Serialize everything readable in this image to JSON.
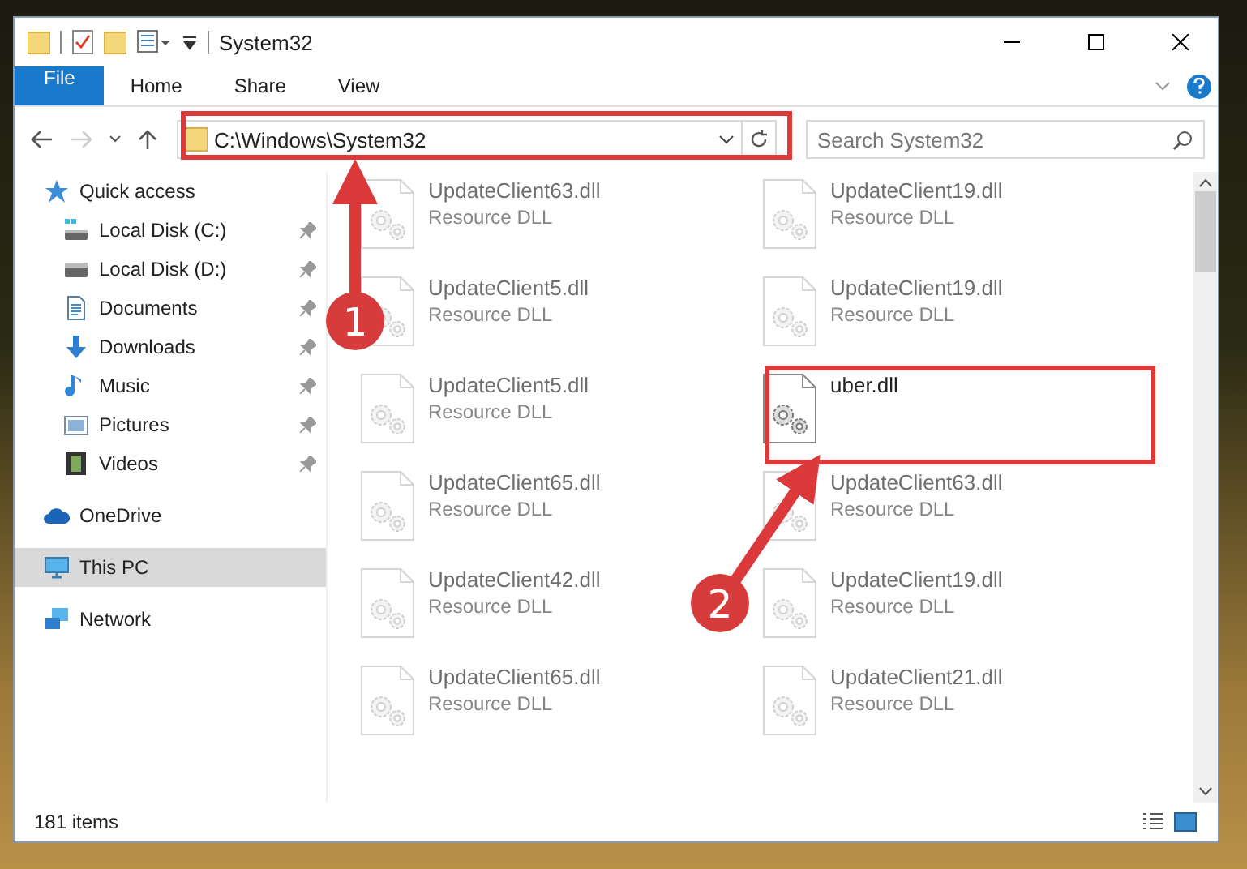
{
  "window": {
    "title": "System32"
  },
  "ribbon_tabs": [
    {
      "label": "File",
      "kind": "file",
      "selected": false
    },
    {
      "label": "Home",
      "kind": "tab",
      "selected": false
    },
    {
      "label": "Share",
      "kind": "tab",
      "selected": false
    },
    {
      "label": "View",
      "kind": "tab",
      "selected": false
    }
  ],
  "navigation": {
    "forward_disabled": true
  },
  "address_bar": {
    "path": "C:\\Windows\\System32"
  },
  "search": {
    "placeholder": "Search System32"
  },
  "sidebar": {
    "items": [
      {
        "label": "Quick access",
        "kind": "star",
        "selected": false,
        "children": [
          {
            "label": "Local Disk (C:)",
            "kind": "drive-c",
            "pinned": true,
            "selected": false
          },
          {
            "label": "Local Disk (D:)",
            "kind": "drive",
            "pinned": true,
            "selected": false
          },
          {
            "label": "Documents",
            "kind": "document",
            "pinned": true,
            "selected": false
          },
          {
            "label": "Downloads",
            "kind": "download",
            "pinned": true,
            "selected": false
          },
          {
            "label": "Music",
            "kind": "music",
            "pinned": true,
            "selected": false
          },
          {
            "label": "Pictures",
            "kind": "pictures",
            "pinned": true,
            "selected": false
          },
          {
            "label": "Videos",
            "kind": "videos",
            "pinned": true,
            "selected": false
          }
        ]
      },
      {
        "label": "OneDrive",
        "kind": "cloud",
        "selected": false
      },
      {
        "label": "This PC",
        "kind": "pc",
        "selected": true
      },
      {
        "label": "Network",
        "kind": "network",
        "selected": false
      }
    ]
  },
  "files": [
    {
      "name": "UpdateClient63.dll",
      "type": "Resource DLL",
      "dimmed": true
    },
    {
      "name": "UpdateClient19.dll",
      "type": "Resource DLL",
      "dimmed": true
    },
    {
      "name": "UpdateClient5.dll",
      "type": "Resource DLL",
      "dimmed": true
    },
    {
      "name": "UpdateClient19.dll",
      "type": "Resource DLL",
      "dimmed": true
    },
    {
      "name": "UpdateClient5.dll",
      "type": "Resource DLL",
      "dimmed": true
    },
    {
      "name": "uber.dll",
      "dimmed": false
    },
    {
      "name": "UpdateClient65.dll",
      "type": "Resource DLL",
      "dimmed": true
    },
    {
      "name": "UpdateClient63.dll",
      "type": "Resource DLL",
      "dimmed": true
    },
    {
      "name": "UpdateClient42.dll",
      "type": "Resource DLL",
      "dimmed": true
    },
    {
      "name": "UpdateClient19.dll",
      "type": "Resource DLL",
      "dimmed": true
    },
    {
      "name": "UpdateClient65.dll",
      "type": "Resource DLL",
      "dimmed": true
    },
    {
      "name": "UpdateClient21.dll",
      "type": "Resource DLL",
      "dimmed": true
    }
  ],
  "status_bar": {
    "item_count": "181 items"
  },
  "annotations": [
    {
      "number": "1"
    },
    {
      "number": "2"
    }
  ]
}
